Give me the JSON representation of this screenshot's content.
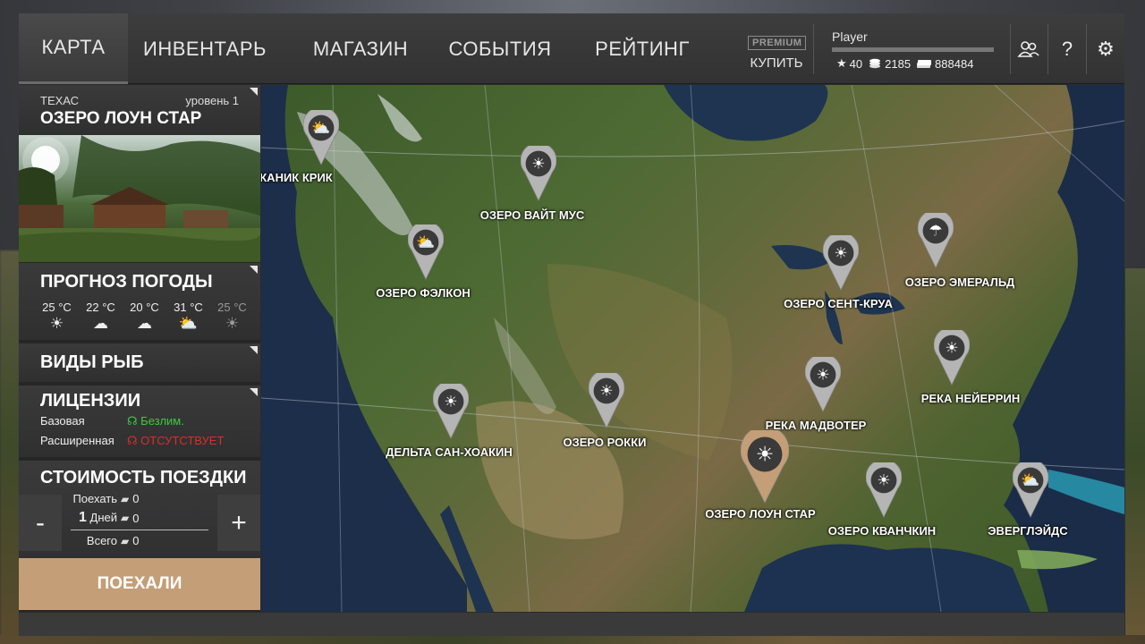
{
  "nav": {
    "tabs": [
      {
        "label": "КАРТА",
        "active": true
      },
      {
        "label": "ИНВЕНТАРЬ",
        "active": false
      },
      {
        "label": "МАГАЗИН",
        "active": false
      },
      {
        "label": "СОБЫТИЯ",
        "active": false
      },
      {
        "label": "РЕЙТИНГ",
        "active": false
      }
    ],
    "premium_badge": "PREMIUM",
    "premium_buy": "КУПИТЬ"
  },
  "player": {
    "name": "Player",
    "xp_progress": 0.0,
    "stars": "40",
    "coins": "2185",
    "cash": "888484"
  },
  "location": {
    "region": "ТЕХАС",
    "level": "уровень 1",
    "name": "ОЗЕРО ЛОУН СТАР"
  },
  "weather": {
    "title": "ПРОГНОЗ ПОГОДЫ",
    "days": [
      {
        "temp": "25 °C",
        "icon": "sun-icon",
        "glyph": "☀",
        "dim": false
      },
      {
        "temp": "22 °C",
        "icon": "cloud-icon",
        "glyph": "☁",
        "dim": false
      },
      {
        "temp": "20 °C",
        "icon": "cloud-icon",
        "glyph": "☁",
        "dim": false
      },
      {
        "temp": "31 °C",
        "icon": "partly-cloudy-icon",
        "glyph": "⛅",
        "dim": false
      },
      {
        "temp": "25 °C",
        "icon": "sun-icon",
        "glyph": "☀",
        "dim": true
      }
    ]
  },
  "fish": {
    "title": "ВИДЫ РЫБ"
  },
  "licenses": {
    "title": "ЛИЦЕНЗИИ",
    "basic_label": "Базовая",
    "basic_value": "Безлим.",
    "extended_label": "Расширенная",
    "extended_value": "ОТСУТСТВУЕТ"
  },
  "trip_cost": {
    "title": "СТОИМОСТЬ ПОЕЗДКИ",
    "go_label": "Поехать",
    "go_value": "0",
    "days_count": "1",
    "days_label": "Дней",
    "days_value": "0",
    "total_label": "Всего",
    "total_value": "0",
    "minus": "-",
    "plus": "+"
  },
  "go_button": "ПОЕХАЛИ",
  "map": {
    "pins": [
      {
        "label": "КАНИК КРИК",
        "weather": "partly-cloudy-icon",
        "selected": false
      },
      {
        "label": "ОЗЕРО ВАЙТ МУС",
        "weather": "sun-icon",
        "selected": false
      },
      {
        "label": "ОЗЕРО ФЭЛКОН",
        "weather": "partly-cloudy-icon",
        "selected": false
      },
      {
        "label": "ОЗЕРО СЕНТ-КРУА",
        "weather": "sun-icon",
        "selected": false
      },
      {
        "label": "ОЗЕРО ЭМЕРАЛЬД",
        "weather": "rain-icon",
        "selected": false
      },
      {
        "label": "РЕКА НЕЙЕРРИН",
        "weather": "sun-icon",
        "selected": false
      },
      {
        "label": "РЕКА МАДВОТЕР",
        "weather": "sun-icon",
        "selected": false
      },
      {
        "label": "ОЗЕРО РОККИ",
        "weather": "sun-icon",
        "selected": false
      },
      {
        "label": "ДЕЛЬТА САН-ХОАКИН",
        "weather": "sun-icon",
        "selected": false
      },
      {
        "label": "ОЗЕРО ЛОУН СТАР",
        "weather": "sun-icon",
        "selected": true
      },
      {
        "label": "ОЗЕРО КВАНЧКИН",
        "weather": "sun-icon",
        "selected": false
      },
      {
        "label": "ЭВЕРГЛЭЙДС",
        "weather": "partly-cloudy-icon",
        "selected": false
      }
    ]
  },
  "colors": {
    "accent": "#c49e76",
    "license_ok": "#3ccb3c",
    "license_missing": "#e02a2a",
    "pin_default": "#b5b5b5",
    "pin_selected": "#c49e76"
  }
}
